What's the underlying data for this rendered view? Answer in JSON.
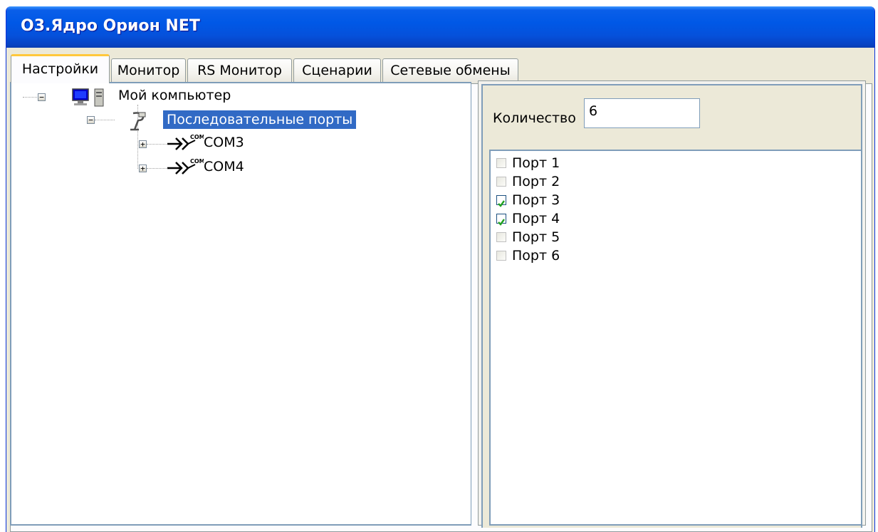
{
  "window": {
    "title": "О3.Ядро Орион NET"
  },
  "tabs": [
    {
      "label": "Настройки",
      "active": true
    },
    {
      "label": "Монитор",
      "active": false
    },
    {
      "label": "RS Монитор",
      "active": false
    },
    {
      "label": "Сценарии",
      "active": false
    },
    {
      "label": "Сетевые обмены",
      "active": false
    }
  ],
  "tree": {
    "root": {
      "label": "Мой компьютер",
      "icon": "computer-icon",
      "expanded": true
    },
    "ports_node": {
      "label": "Последовательные порты",
      "icon": "serial-cable-icon",
      "expanded": true,
      "selected": true
    },
    "com_ports": [
      {
        "label": "COM3",
        "icon": "com-port-icon",
        "icon_text": "COM",
        "expanded": false
      },
      {
        "label": "COM4",
        "icon": "com-port-icon",
        "icon_text": "COM",
        "expanded": false
      }
    ]
  },
  "settings": {
    "count_label": "Количество",
    "count_value": "6",
    "ports": [
      {
        "label": "Порт 1",
        "checked": false
      },
      {
        "label": "Порт 2",
        "checked": false
      },
      {
        "label": "Порт 3",
        "checked": true
      },
      {
        "label": "Порт 4",
        "checked": true
      },
      {
        "label": "Порт 5",
        "checked": false
      },
      {
        "label": "Порт 6",
        "checked": false
      }
    ]
  },
  "colors": {
    "titlebar": "#0058e6",
    "selection": "#316ac5",
    "checkmark": "#21a121",
    "active_tab_accent": "#ffc83c"
  }
}
